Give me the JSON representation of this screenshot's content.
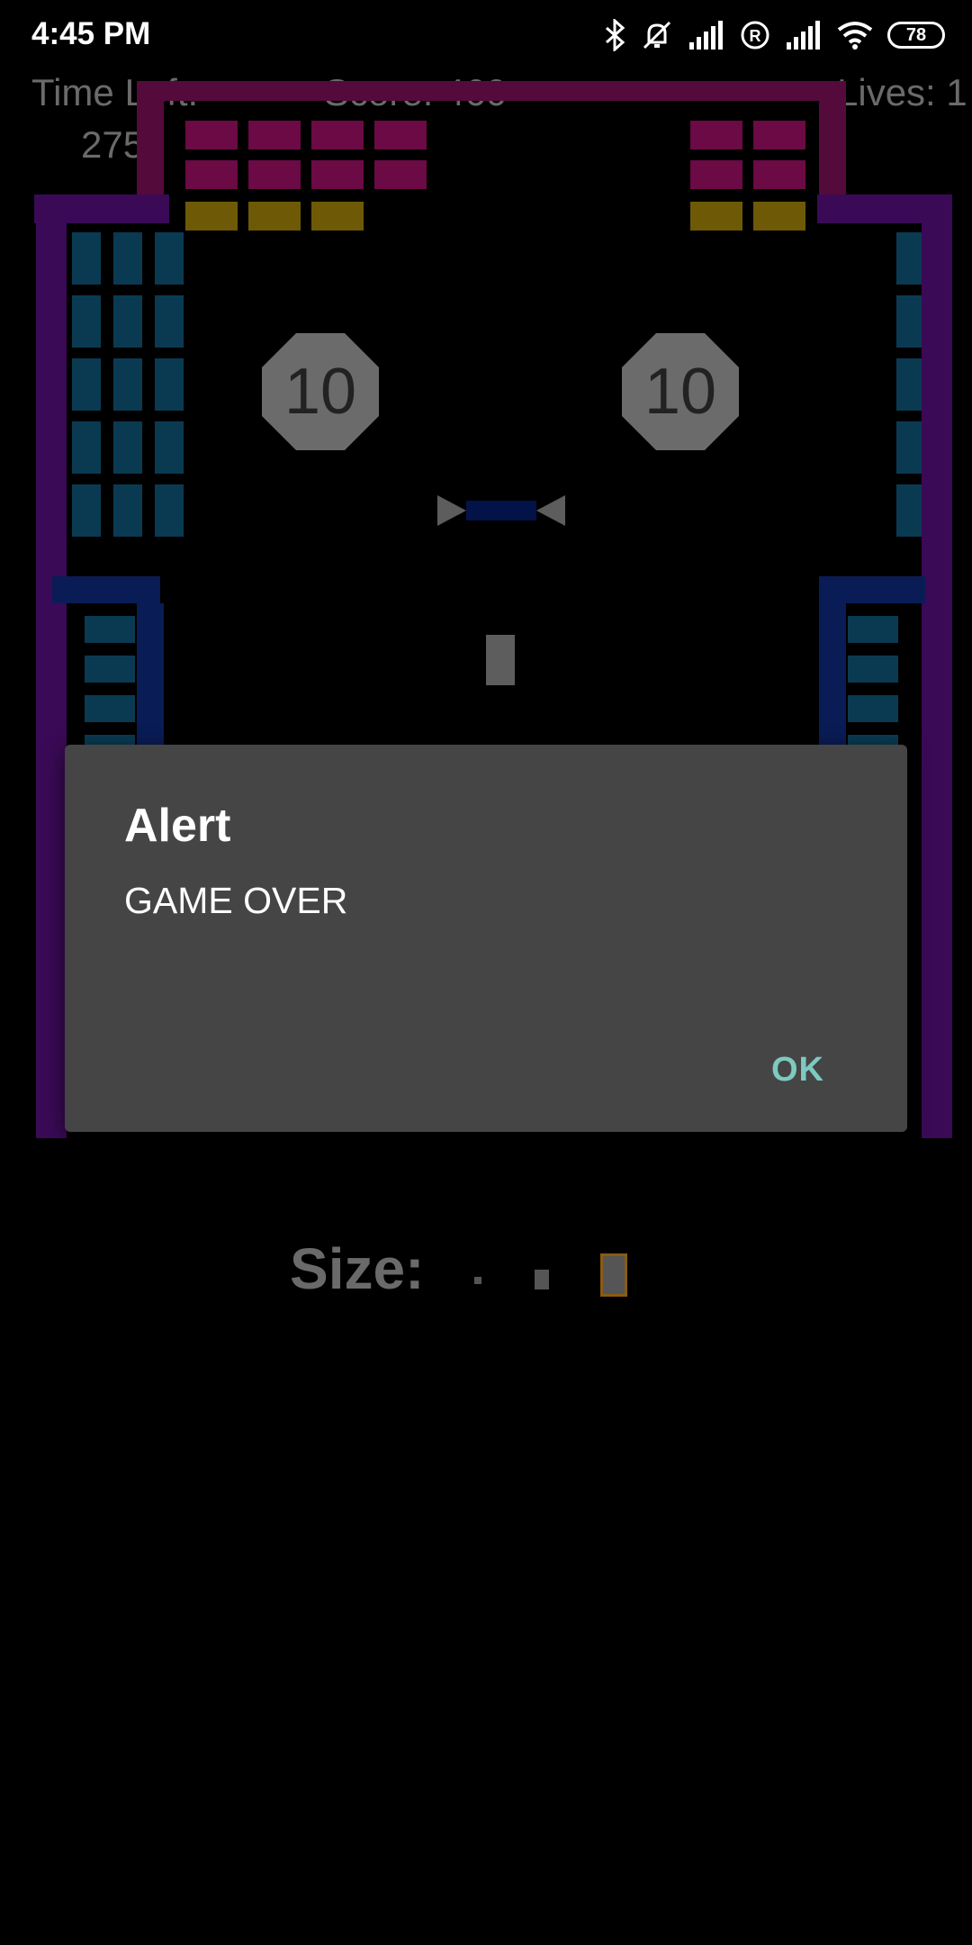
{
  "status_bar": {
    "time": "4:45 PM",
    "battery": "78",
    "icons": [
      "bluetooth-icon",
      "silent-icon",
      "signal-icon",
      "registered-icon",
      "signal-icon",
      "wifi-icon",
      "battery-icon"
    ]
  },
  "hud": {
    "time_left_label": "Time Left:",
    "time_left_value": "275s",
    "score": "Score: 460",
    "lives": "Lives: 1"
  },
  "bumpers": [
    {
      "value": "10"
    },
    {
      "value": "10"
    }
  ],
  "dialog": {
    "title": "Alert",
    "message": "GAME OVER",
    "ok_label": "OK"
  },
  "size_selector": {
    "label": "Size:",
    "options": [
      "small",
      "medium",
      "large"
    ],
    "selected": "large"
  },
  "colors": {
    "brick_magenta": "#6b0a44",
    "brick_yellow": "#6e5a06",
    "brick_cyan": "#0a3a52",
    "wall_purple": "#3a0a56",
    "wall_blue": "#0a1c56",
    "dialog_bg": "#454545",
    "ok_accent": "#7ec9c0",
    "selected_outline": "#8a5b12"
  }
}
